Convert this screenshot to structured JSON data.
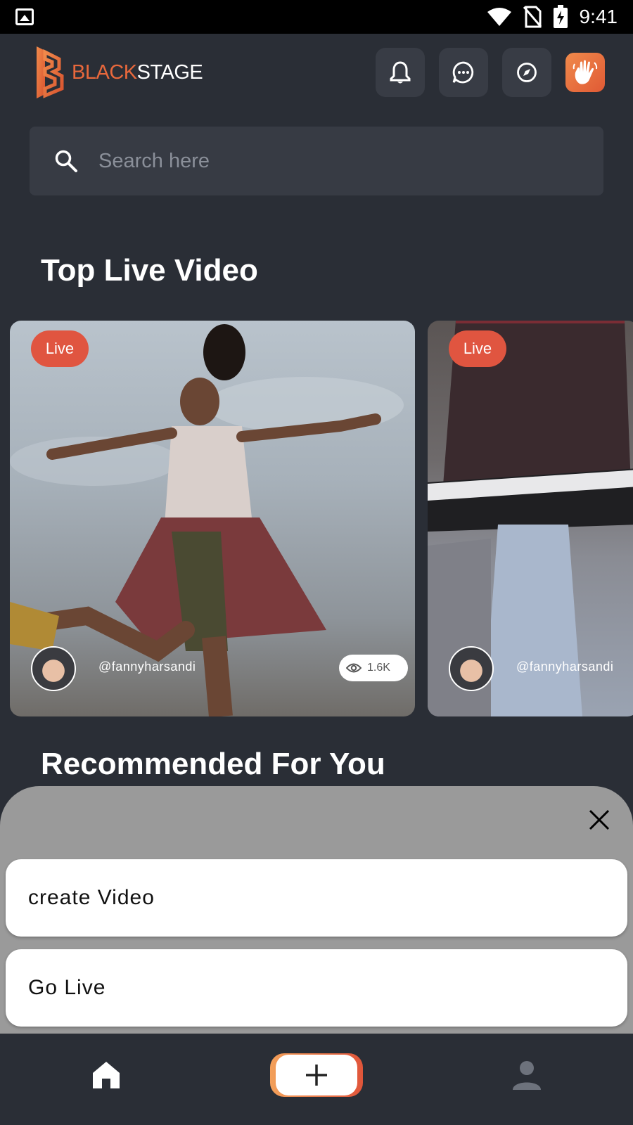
{
  "status_bar": {
    "time": "9:41"
  },
  "header": {
    "logo": {
      "part1": "BLACK",
      "part2": "STAGE"
    },
    "icons": [
      "bell-icon",
      "chat-icon",
      "compass-icon",
      "hand-wave-icon"
    ]
  },
  "search": {
    "placeholder": "Search here"
  },
  "top_live": {
    "title": "Top Live Video",
    "cards": [
      {
        "badge": "Live",
        "username": "@fannyharsandi",
        "views": "1.6K"
      },
      {
        "badge": "Live",
        "username": "@fannyharsandi"
      }
    ]
  },
  "recommended": {
    "title": "Recommended For You"
  },
  "sheet": {
    "options": [
      {
        "label": "create Video"
      },
      {
        "label": "Go Live"
      }
    ]
  },
  "bottom_nav": {
    "items": [
      "home-icon",
      "add-icon",
      "profile-icon"
    ]
  },
  "colors": {
    "accent": "#e05540",
    "background": "#2a2e36",
    "brand_orange": "#e8683c"
  }
}
